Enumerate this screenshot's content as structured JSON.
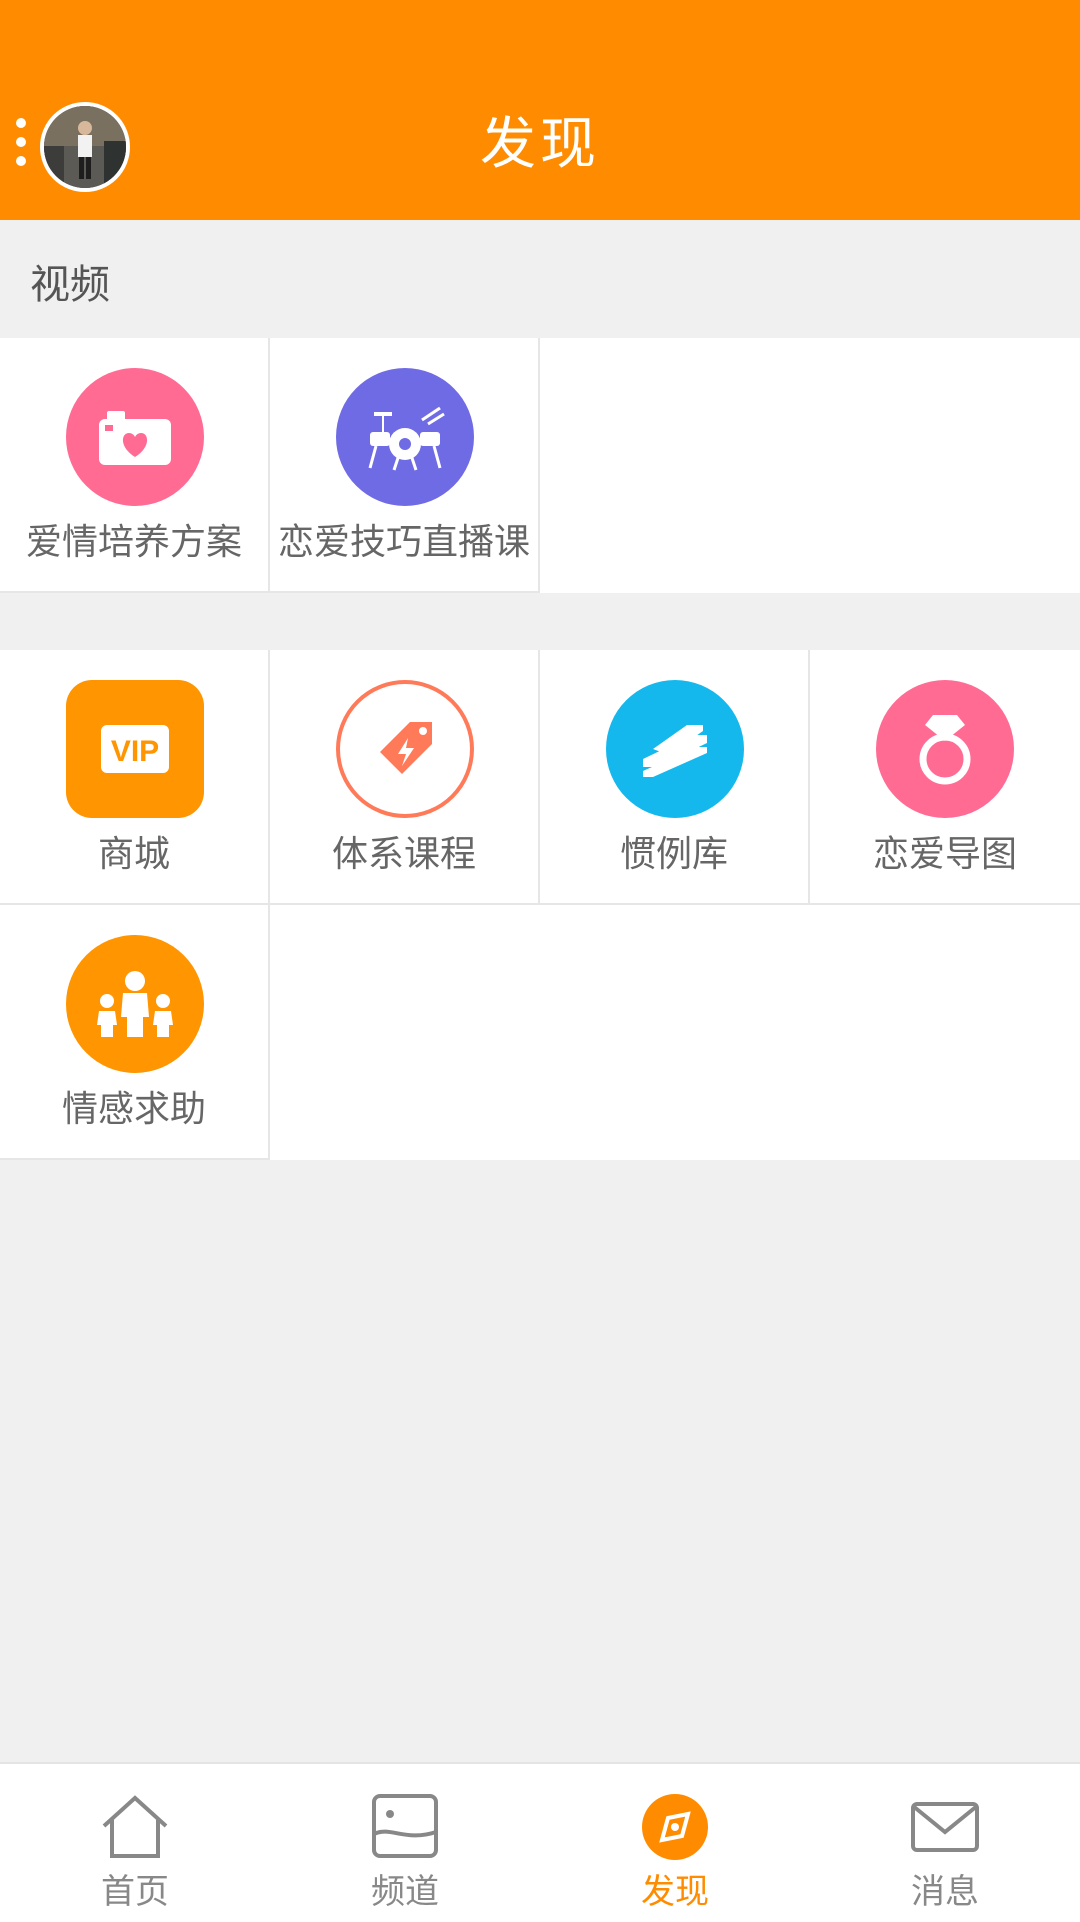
{
  "header": {
    "title": "发现"
  },
  "section_video": {
    "title": "视频",
    "items": [
      {
        "label": "爱情培养方案",
        "icon": "camera-heart-icon",
        "color": "#ff6b93"
      },
      {
        "label": "恋爱技巧直播课",
        "icon": "drum-kit-icon",
        "color": "#6f6be4"
      }
    ]
  },
  "section_tools": {
    "items": [
      {
        "label": "商城",
        "icon": "vip-icon",
        "color": "#ff9500"
      },
      {
        "label": "体系课程",
        "icon": "lightning-tag-icon",
        "color": "#ff7a59"
      },
      {
        "label": "惯例库",
        "icon": "stack-icon",
        "color": "#14b8ec"
      },
      {
        "label": "恋爱导图",
        "icon": "diamond-ring-icon",
        "color": "#ff6b93"
      },
      {
        "label": "情感求助",
        "icon": "family-icon",
        "color": "#ff9500"
      }
    ]
  },
  "tabbar": {
    "items": [
      {
        "label": "首页",
        "icon": "home-icon"
      },
      {
        "label": "频道",
        "icon": "image-icon"
      },
      {
        "label": "发现",
        "icon": "compass-icon",
        "active": true
      },
      {
        "label": "消息",
        "icon": "mail-icon"
      }
    ]
  },
  "colors": {
    "accent": "#ff8c00",
    "background": "#f0f0f0"
  }
}
